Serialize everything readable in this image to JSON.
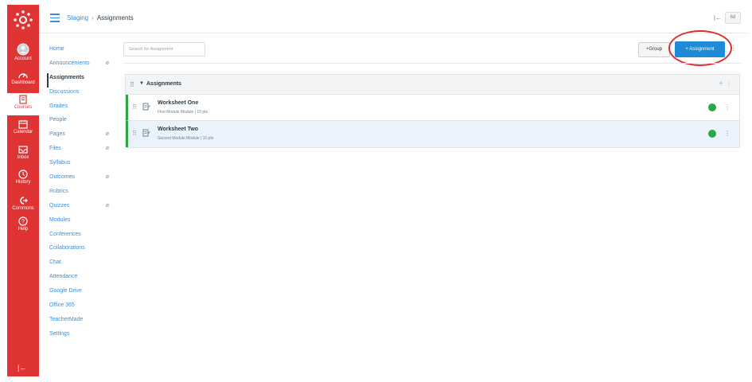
{
  "global_nav": {
    "items": [
      {
        "label": "Account",
        "icon": "account-icon"
      },
      {
        "label": "Dashboard",
        "icon": "dashboard-icon"
      },
      {
        "label": "Courses",
        "icon": "courses-icon",
        "active": true
      },
      {
        "label": "Calendar",
        "icon": "calendar-icon"
      },
      {
        "label": "Inbox",
        "icon": "inbox-icon"
      },
      {
        "label": "History",
        "icon": "history-icon"
      },
      {
        "label": "Commons",
        "icon": "commons-icon"
      },
      {
        "label": "Help",
        "icon": "help-icon"
      }
    ],
    "collapse_glyph": "|←",
    "brand_color": "#e03333"
  },
  "header": {
    "breadcrumb_course": "Staging",
    "breadcrumb_separator": "›",
    "breadcrumb_current": "Assignments",
    "right_icon_glyph": "|←",
    "right_button": "6d"
  },
  "course_nav": {
    "items": [
      {
        "label": "Home",
        "hidden": false
      },
      {
        "label": "Announcements",
        "hidden": true
      },
      {
        "label": "Assignments",
        "hidden": false,
        "active": true
      },
      {
        "label": "Discussions",
        "hidden": false
      },
      {
        "label": "Grades",
        "hidden": false
      },
      {
        "label": "People",
        "hidden": false
      },
      {
        "label": "Pages",
        "hidden": true
      },
      {
        "label": "Files",
        "hidden": true
      },
      {
        "label": "Syllabus",
        "hidden": false
      },
      {
        "label": "Outcomes",
        "hidden": true
      },
      {
        "label": "Rubrics",
        "hidden": false
      },
      {
        "label": "Quizzes",
        "hidden": true
      },
      {
        "label": "Modules",
        "hidden": false
      },
      {
        "label": "Conferences",
        "hidden": false
      },
      {
        "label": "Collaborations",
        "hidden": false
      },
      {
        "label": "Chat",
        "hidden": false
      },
      {
        "label": "Attendance",
        "hidden": false
      },
      {
        "label": "Google Drive",
        "hidden": false
      },
      {
        "label": "Office 365",
        "hidden": false
      },
      {
        "label": "TeacherMade",
        "hidden": false
      },
      {
        "label": "Settings",
        "hidden": false
      }
    ],
    "hidden_glyph": "ø"
  },
  "toolbar": {
    "search_placeholder": "Search for Assignment",
    "group_button": "+Group",
    "assignment_button": "+ Assignment",
    "kebab_glyph": "⋮",
    "accent_color": "#1f8ad6",
    "callout_color": "#d9302f"
  },
  "assignment_group": {
    "title": "Assignments",
    "drag_glyph": "⠿",
    "caret_glyph": "▼",
    "add_glyph": "+",
    "kebab_glyph": "⋮",
    "assignments": [
      {
        "title": "Worksheet One",
        "meta": "First Module Module  |  10 pts",
        "published": true
      },
      {
        "title": "Worksheet Two",
        "meta": "Second Module Module  |  10 pts",
        "published": true,
        "selected": true
      }
    ],
    "published_color": "#2aa843"
  }
}
